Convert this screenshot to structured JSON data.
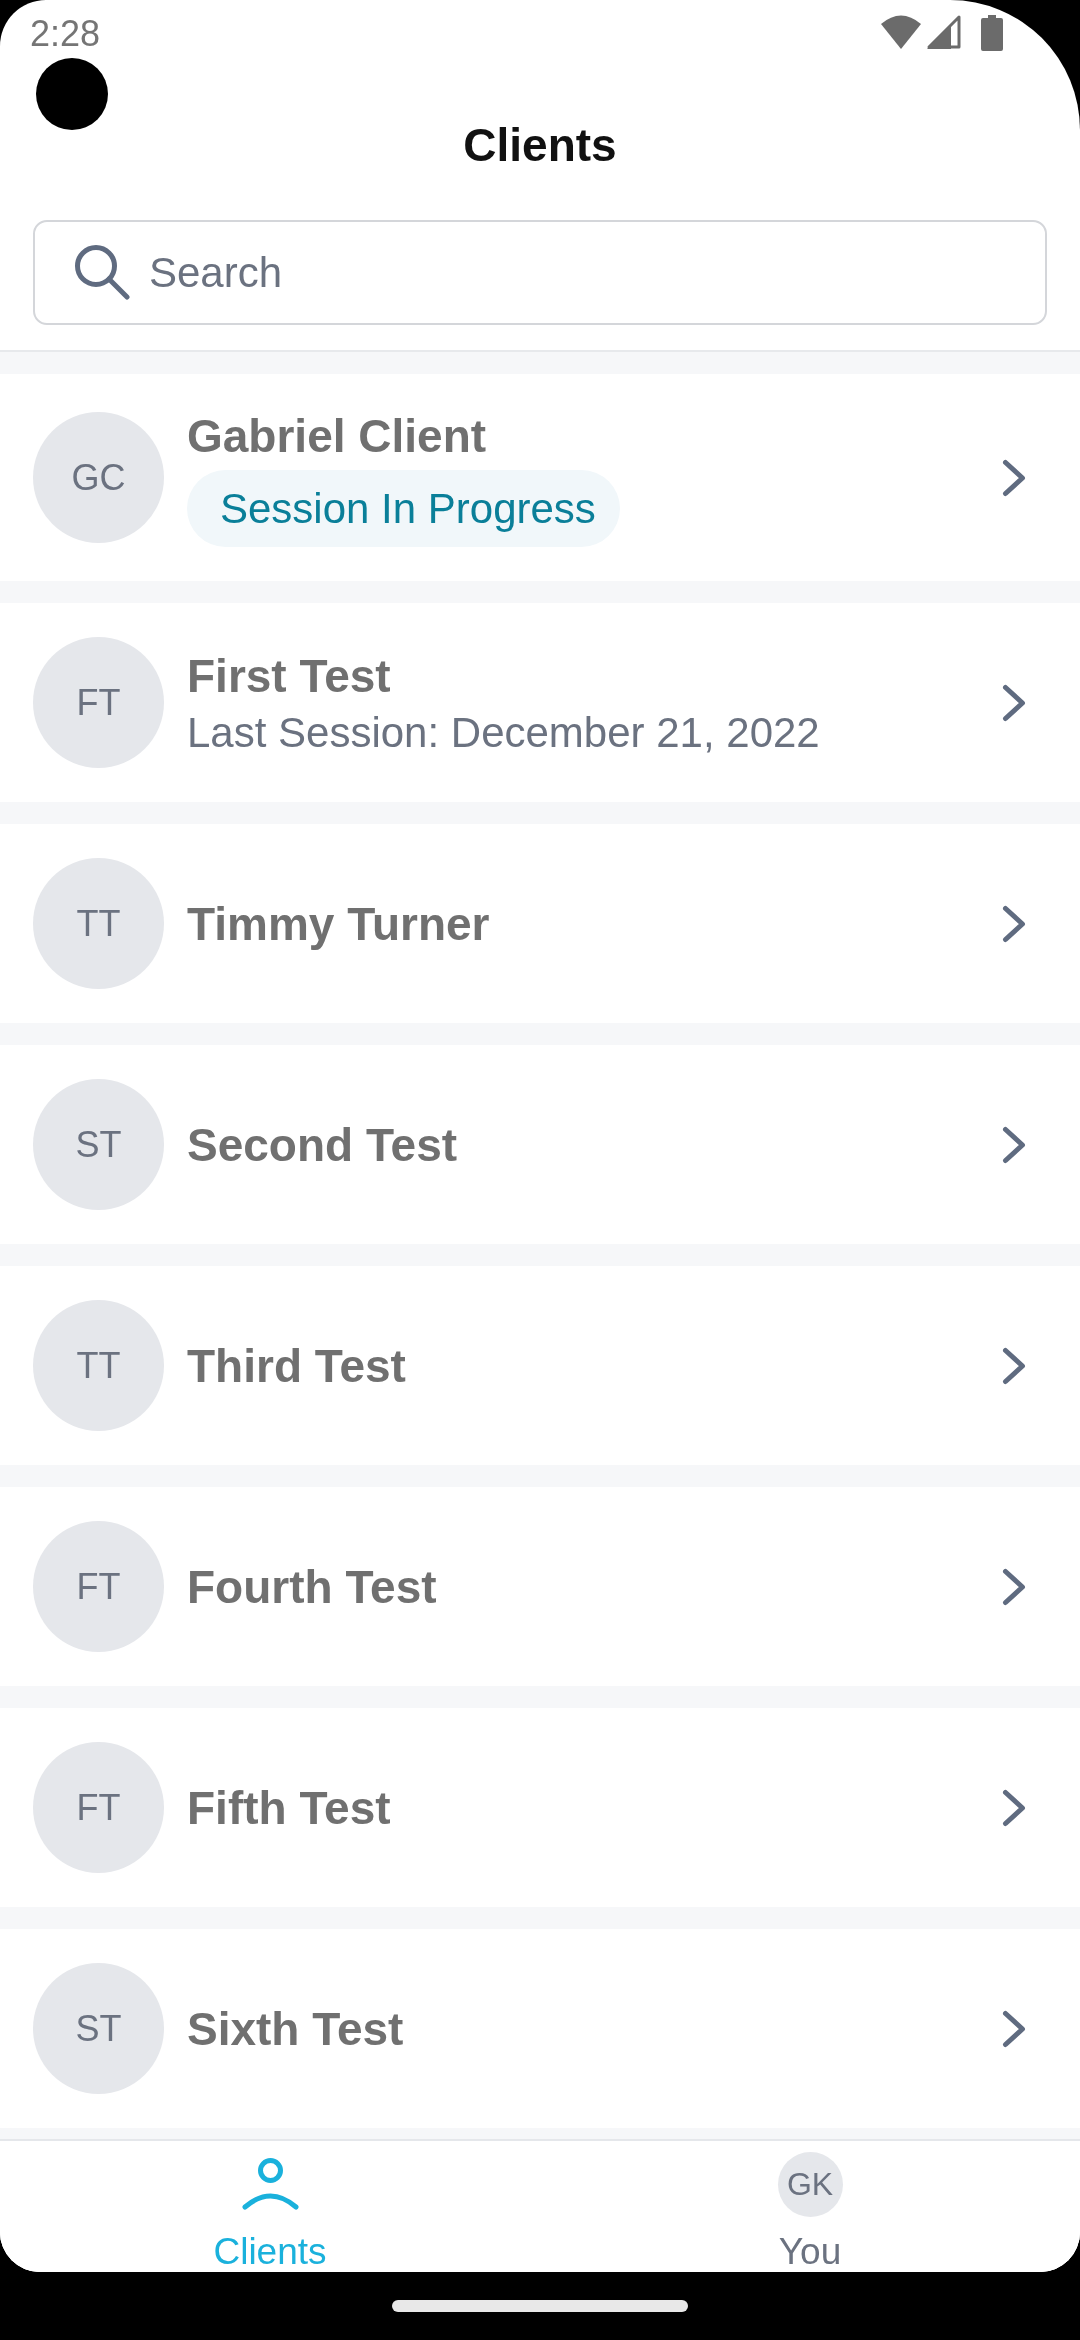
{
  "status_bar": {
    "time": "2:28"
  },
  "header": {
    "title": "Clients"
  },
  "search": {
    "placeholder": "Search"
  },
  "clients": [
    {
      "initials": "GC",
      "name": "Gabriel Client",
      "kind": "badge",
      "subtitle": "Session In Progress"
    },
    {
      "initials": "FT",
      "name": "First Test",
      "kind": "detail",
      "subtitle": "Last Session: December 21, 2022"
    },
    {
      "initials": "TT",
      "name": "Timmy Turner",
      "kind": "plain"
    },
    {
      "initials": "ST",
      "name": "Second Test",
      "kind": "plain"
    },
    {
      "initials": "TT",
      "name": "Third Test",
      "kind": "plain"
    },
    {
      "initials": "FT",
      "name": "Fourth Test",
      "kind": "plain"
    },
    {
      "initials": "FT",
      "name": "Fifth Test",
      "kind": "plain"
    },
    {
      "initials": "ST",
      "name": "Sixth Test",
      "kind": "plain"
    }
  ],
  "bottom_nav": [
    {
      "kind": "icon",
      "label": "Clients",
      "selected": true
    },
    {
      "kind": "avatar",
      "initials": "GK",
      "label": "You",
      "selected": false
    }
  ]
}
